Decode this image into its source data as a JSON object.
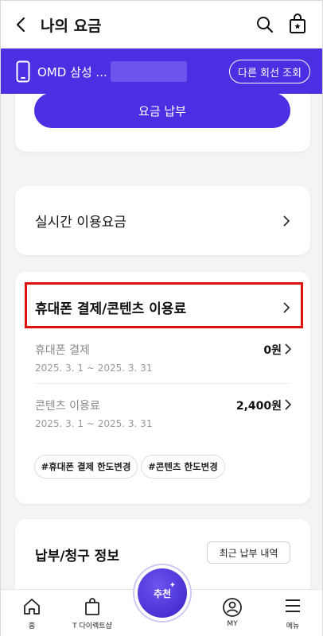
{
  "header": {
    "title": "나의 요금"
  },
  "line": {
    "name": "OMD 삼성 ...",
    "other_button": "다른 회선 조회"
  },
  "pay": {
    "button": "요금 납부"
  },
  "realtime": {
    "label": "실시간 이용요금"
  },
  "fees": {
    "heading": "휴대폰 결제/콘텐츠 이용료",
    "rows": [
      {
        "title": "휴대폰 결제",
        "period": "2025. 3. 1 ~ 2025. 3. 31",
        "amount": "0원"
      },
      {
        "title": "콘텐츠 이용료",
        "period": "2025. 3. 1 ~ 2025. 3. 31",
        "amount": "2,400원"
      }
    ],
    "chips": [
      "#휴대폰 결제 한도변경",
      "#콘텐츠 한도변경"
    ]
  },
  "billing": {
    "label": "납부/청구 정보",
    "history_button": "최근 납부 내역"
  },
  "tabbar": {
    "home": "홈",
    "direct": "T 다이렉트샵",
    "recommend": "추천",
    "my": "MY",
    "menu": "메뉴"
  },
  "colors": {
    "brand": "#4b2fe3",
    "highlight": "#e01010"
  }
}
